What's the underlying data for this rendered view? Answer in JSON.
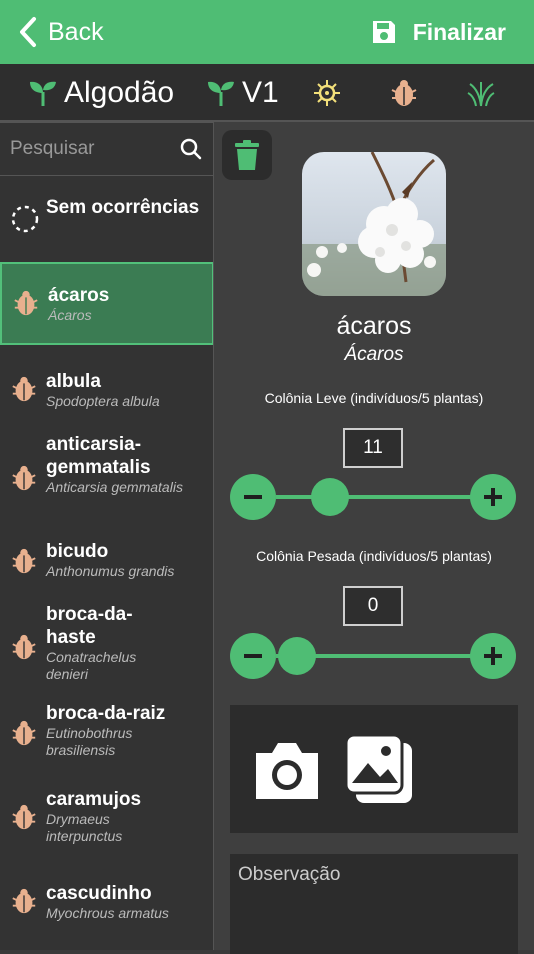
{
  "header": {
    "back_label": "Back",
    "finalize_label": "Finalizar",
    "color": "#4fbd74"
  },
  "crop_bar": {
    "crop_label": "Algodão",
    "stage_label": "V1",
    "icons": [
      "sprout-icon",
      "sprout-icon",
      "virus-icon",
      "bug-icon",
      "weed-icon"
    ]
  },
  "sidebar": {
    "search_placeholder": "Pesquisar",
    "items": [
      {
        "name": "Sem ocorrências",
        "sci": ""
      },
      {
        "name": "ácaros",
        "sci": "Ácaros"
      },
      {
        "name": "albula",
        "sci": "Spodoptera albula"
      },
      {
        "name": "anticarsia-gemmatalis",
        "sci": "Anticarsia gemmatalis"
      },
      {
        "name": "bicudo",
        "sci": "Anthonumus grandis"
      },
      {
        "name": "broca-da-haste",
        "sci": "Conatrachelus denieri"
      },
      {
        "name": "broca-da-raiz",
        "sci": "Eutinobothrus brasiliensis"
      },
      {
        "name": "caramujos",
        "sci": "Drymaeus interpunctus"
      },
      {
        "name": "cascudinho",
        "sci": "Myochrous armatus"
      }
    ],
    "selected_index": 1
  },
  "detail": {
    "name": "ácaros",
    "sci": "Ácaros",
    "light_label": "Colônia Leve (indivíduos/5 plantas)",
    "light_value": "11",
    "heavy_label": "Colônia Pesada (indivíduos/5 plantas)",
    "heavy_value": "0",
    "observation_placeholder": "Observação"
  }
}
